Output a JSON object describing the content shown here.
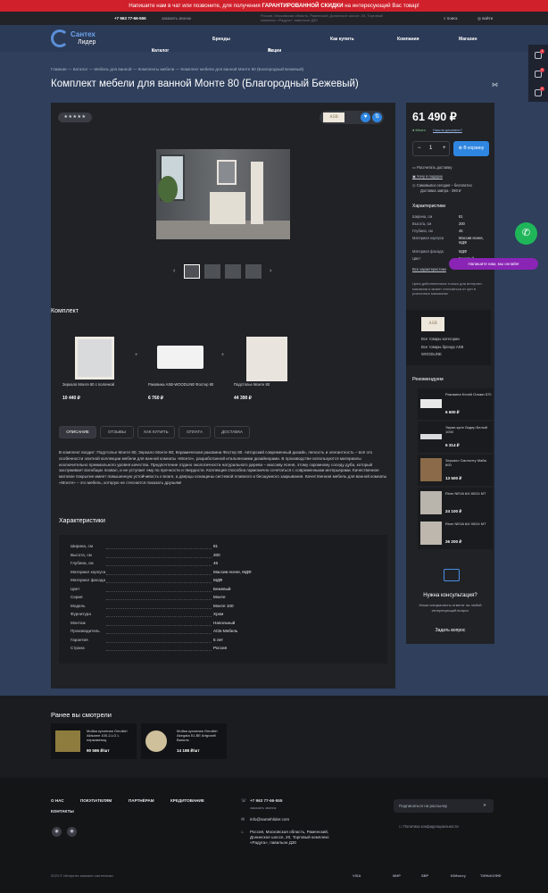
{
  "promo": {
    "text_before": "Напишите нам в чат или позвоните, для получения ",
    "bold": "ГАРАНТИРОВАННОЙ СКИДКИ",
    "text_after": " на интересующий Вас товар!"
  },
  "topbar": {
    "phone": "+7 963 77-66-555",
    "callback": "заказать звонок",
    "address": "Россия, Московская область, Раменский, Донинское шоссе, 20, Торговый комплекс «Радуга», павильон Д30",
    "search": "поиск",
    "login": "войти"
  },
  "logo": {
    "line1": "Сантех",
    "line2": "Лидер"
  },
  "nav": [
    "Каталог",
    "Бренды",
    "Акции",
    "Как купить",
    "Компания",
    "Магазин"
  ],
  "rightbar": {
    "badges": [
      "1",
      "0",
      "0"
    ]
  },
  "breadcrumb": "Главная  —  Каталог  —  Мебель для ванной  —  Комплекты мебели  —  Комплект мебели для ванной Монте 80 (Благородный Бежевый)",
  "page_title": "Комплект мебели для ванной Монте 80 (Благородный Бежевый)",
  "rating": "★★★★★",
  "brand_small": "ASB",
  "kit": {
    "title": "Комплект",
    "items": [
      {
        "name": "Зеркало Монте 80 с полочкой",
        "price": "10 440 ₽"
      },
      {
        "name": "Раковина ASB-WOODLINE Фостер 80",
        "price": "6 760 ₽"
      },
      {
        "name": "Подстолье Монте 80",
        "price": "44 390 ₽"
      }
    ]
  },
  "tabs": [
    "ОПИСАНИЕ",
    "ОТЗЫВЫ",
    "КАК КУПИТЬ",
    "ОПЛАТА",
    "ДОСТАВКА"
  ],
  "description": "В комплект входит: Подстолье Монте 80; Зеркало Монте 80; Керамическая раковина Фостер 80. Авторский современный дизайн, легкость и элегантность – всё это особенности элитной коллекции мебели для ванной комнаты «Монте», разработанной итальянскими дизайнерами. В производстве используются материалы исключительно премиального уровня качества. Предпочтение отдано экологичности натурального дерева – массиву ясеня, этому скромному соседу дуба, который заслуживает всеобщих похвал, и не уступает ему по прочности и твердости. Коллекция способна гармонично сочетаться с современными интерьерами. Качественное матовое покрытие имеет повышенную устойчивость к влаге, а дверцы оснащены системой плавного и бесшумного закрывания. Качественная мебель для ванной комнаты «Монте» – это мебель, которую не стеснются показать друзьям!",
  "specs_title": "Характеристики",
  "specs": [
    [
      "Ширина, см",
      "81"
    ],
    [
      "Высота, см",
      "200"
    ],
    [
      "Глубина, см",
      "46"
    ],
    [
      "Материал корпуса",
      "Массив ясеня, МДФ"
    ],
    [
      "Материал фасада",
      "МДФ"
    ],
    [
      "Цвет",
      "Бежевый"
    ],
    [
      "Серия",
      "Монте"
    ],
    [
      "Модель",
      "Монте 100"
    ],
    [
      "Фурнитура",
      "Хром"
    ],
    [
      "Монтаж",
      "Напольный"
    ],
    [
      "Производитель",
      "АСБ-Мебель"
    ],
    [
      "Гарантия",
      "5 лет"
    ],
    [
      "Страна",
      "Россия"
    ]
  ],
  "side": {
    "price": "61 490 ₽",
    "in_stock": "● Много",
    "sale_link": "Нашли дешевле?",
    "qty": "1",
    "cart": "В корзину",
    "lines": [
      "Рассчитать доставку",
      "Хочу в подарок",
      "Самовывоз сегодня – бесплатно",
      "Доставка завтра - 390 ₽"
    ],
    "char_title": "Характеристики",
    "chars": [
      [
        "Ширина, см",
        "81"
      ],
      [
        "Высота, см",
        "200"
      ],
      [
        "Глубина, см",
        "46"
      ],
      [
        "Материал корпуса",
        "Массив ясеня, МДФ"
      ],
      [
        "Материал фасада",
        "МДФ"
      ],
      [
        "Цвет",
        "Бежевый"
      ]
    ],
    "all_chars": "Все характеристики",
    "note": "Цена действительна только для интернет-магазина и может отличаться от цен в розничных магазинах"
  },
  "brandcard": {
    "logo": "ASB",
    "l1": "Все товары категории",
    "l2": "Все товары бренда ASB",
    "l3": "WOODLINE"
  },
  "recommended": {
    "title": "Рекомендуем",
    "items": [
      {
        "name": "Раковина Kerolit Олимп 570",
        "price": "6 600 ₽"
      },
      {
        "name": "Экран-купе Лидер Белый 1000",
        "price": "6 314 ₽"
      },
      {
        "name": "Зеркало Смоталту Майа 600",
        "price": "13 500 ₽"
      },
      {
        "name": "River NEVA 6/4 80/24 МТ",
        "price": "24 100 ₽"
      },
      {
        "name": "River NEVA 6/4 90/24 МТ",
        "price": "26 200 ₽"
      }
    ]
  },
  "consult": {
    "title": "Нужна консультация?",
    "sub": "Наши специалисты ответят на любой интересующий вопрос",
    "button": "Задать вопрос"
  },
  "chat": {
    "popup": "Напишите нам, мы онлайн!"
  },
  "recent": {
    "title": "Ранее вы смотрели",
    "items": [
      {
        "name": "Мойка кухонная Omoikiri Akisame 100-2-LG L нержавеющ",
        "price": "90 586 ₽/шт"
      },
      {
        "name": "Мойка кухонная Omoikiri Akegata 51-BE Artgranit/Ваниль",
        "price": "14 188 ₽/шт"
      }
    ]
  },
  "footer": {
    "links": [
      "О НАС",
      "ПОКУПАТЕЛЯМ",
      "ПАРТНЁРАМ",
      "КРЕДИТОВАНИЕ",
      "КОНТАКТЫ"
    ],
    "phone": "+7 963 77-66-555",
    "callback": "заказать звонок",
    "email": "info@santehlider.com",
    "address": "Россия, Московская область, Раменский, Донинское шоссе, 20, Торговый комплекс «Радуга», павильон Д30",
    "subscribe": "Подписаться на рассылку",
    "privacy": "Политика конфиденциальности",
    "copy": "2023 © Интернет-магазин сантехники",
    "pay": [
      "VISA",
      "МИР",
      "SBP",
      "ЮMoney",
      "ТИНЬКОФФ"
    ]
  }
}
